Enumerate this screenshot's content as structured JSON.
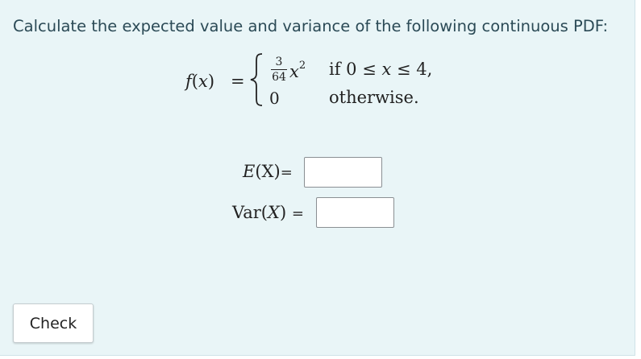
{
  "question": {
    "text": "Calculate the expected value and variance of the following continuous PDF:"
  },
  "pdf": {
    "lhs_func": "f",
    "lhs_open": "(",
    "lhs_var": "x",
    "lhs_close": ")",
    "equals": "=",
    "case1_numerator": "3",
    "case1_denominator": "64",
    "case1_var": "x",
    "case1_exponent": "2",
    "case1_condition_prefix": "if 0 ≤ ",
    "case1_condition_var": "x",
    "case1_condition_suffix": " ≤ 4,",
    "case2_value": "0",
    "case2_condition": "otherwise."
  },
  "answers": {
    "expected_func": "E",
    "expected_arg": "(X)",
    "expected_equals": "=",
    "expected_value": "",
    "variance_func": "Var",
    "variance_open": "(",
    "variance_var": "X",
    "variance_close": ")",
    "variance_equals": "=",
    "variance_value": ""
  },
  "actions": {
    "check_label": "Check"
  },
  "colors": {
    "panel_background": "#e9f5f7",
    "question_text": "#2b4a56",
    "input_border": "#8a8f93"
  }
}
